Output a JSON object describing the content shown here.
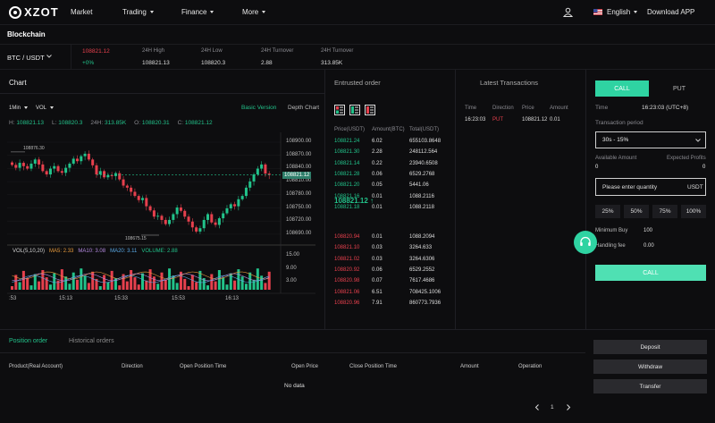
{
  "header": {
    "logo": "XZOT",
    "nav": [
      "Market",
      "Trading",
      "Finance",
      "More"
    ],
    "language": "English",
    "download": "Download APP"
  },
  "section": "Blockchain",
  "ticker": {
    "pair": "BTC / USDT",
    "price": "108821.12",
    "change": "+0%",
    "stats": [
      {
        "label": "24H High",
        "value": "108821.13"
      },
      {
        "label": "24H Low",
        "value": "108820.3"
      },
      {
        "label": "24H Turnover",
        "value": "2.88"
      },
      {
        "label": "24H Turnover",
        "value": "313.85K"
      }
    ]
  },
  "chart": {
    "title": "Chart",
    "interval": "1Min",
    "indicator": "VOL",
    "basic": "Basic Version",
    "depth": "Depth Chart",
    "ohlc": [
      {
        "k": "H:",
        "v": "108821.13"
      },
      {
        "k": "L:",
        "v": "108820.3"
      },
      {
        "k": "24H:",
        "v": "313.85K"
      },
      {
        "k": "O:",
        "v": "108820.31"
      },
      {
        "k": "C:",
        "v": "108821.12"
      }
    ],
    "price_ticks": [
      "108900.00",
      "108870.00",
      "108840.00",
      "108810.00",
      "108780.00",
      "108750.00",
      "108720.00",
      "108690.00"
    ],
    "current": "108821.12",
    "high_label": "108876.30",
    "low_label": "108675.15",
    "vol_legend": [
      {
        "t": "VOL(5,10,20)",
        "c": "#cfcfcf"
      },
      {
        "t": "MA5: 2.33",
        "c": "#e89a3c"
      },
      {
        "t": "MA10: 3.08",
        "c": "#b48ae0"
      },
      {
        "t": "MA20: 3.11",
        "c": "#5aa9e6"
      },
      {
        "t": "VOLUME: 2.88",
        "c": "#22c28a"
      }
    ],
    "vol_ticks": [
      "15.00",
      "9.00",
      "3.00"
    ],
    "time_ticks": [
      ":53",
      "15:13",
      "15:33",
      "15:53",
      "16:13"
    ]
  },
  "chart_data": {
    "type": "candlestick",
    "ylim": [
      108660,
      108915
    ],
    "low": 108675.15,
    "high": 108876.3,
    "last": 108821.12,
    "closes": [
      108845,
      108838,
      108850,
      108842,
      108836,
      108848,
      108858,
      108846,
      108830,
      108822,
      108836,
      108842,
      108830,
      108826,
      108838,
      108848,
      108860,
      108854,
      108866,
      108872,
      108858,
      108844,
      108822,
      108830,
      108815,
      108820,
      108818,
      108825,
      108810,
      108795,
      108790,
      108780,
      108770,
      108760,
      108765,
      108745,
      108735,
      108720,
      108722,
      108712,
      108702,
      108712,
      108726,
      108742,
      108734,
      108720,
      108708,
      108694,
      108684,
      108692,
      108712,
      108726,
      108706,
      108700,
      108716,
      108728,
      108740,
      108750,
      108745,
      108762,
      108770,
      108790,
      108805,
      108822,
      108836,
      108846,
      108824,
      108821
    ]
  },
  "orders": {
    "title": "Entrusted order",
    "cols": [
      "Price(USDT)",
      "Amount(BTC)",
      "Total(USDT)"
    ],
    "bids": [
      [
        "108821.24",
        "6.02",
        "655103.8648"
      ],
      [
        "108821.30",
        "2.28",
        "248112.564"
      ],
      [
        "108821.14",
        "0.22",
        "23940.6508"
      ],
      [
        "108821.28",
        "0.06",
        "6529.2768"
      ],
      [
        "108821.20",
        "0.05",
        "5441.06"
      ],
      [
        "108821.16",
        "0.01",
        "1088.2116"
      ],
      [
        "108821.18",
        "0.01",
        "1088.2118"
      ]
    ],
    "mid": "108821.12 ↑",
    "asks": [
      [
        "108820.94",
        "0.01",
        "1088.2094"
      ],
      [
        "108821.10",
        "0.03",
        "3264.633"
      ],
      [
        "108821.02",
        "0.03",
        "3264.6306"
      ],
      [
        "108820.92",
        "0.06",
        "6529.2552"
      ],
      [
        "108820.98",
        "0.07",
        "7617.4686"
      ],
      [
        "108821.06",
        "6.51",
        "708425.1006"
      ],
      [
        "108820.96",
        "7.91",
        "860773.7936"
      ]
    ]
  },
  "trades": {
    "title": "Latest Transactions",
    "cols": [
      "Time",
      "Direction",
      "Price",
      "Amount"
    ],
    "row": [
      "16:23:03",
      "PUT",
      "108821.12",
      "0.01"
    ]
  },
  "trade": {
    "call": "CALL",
    "put": "PUT",
    "time_label": "Time",
    "time_value": "16:23:03 (UTC+8)",
    "period_label": "Transaction period",
    "period_value": "30s - 15%",
    "avail_label": "Available Amount",
    "avail_value": "0",
    "profit_label": "Expected Profits",
    "profit_value": "0",
    "qty_placeholder": "Please enter  quantity",
    "unit": "USDT",
    "pcts": [
      "25%",
      "50%",
      "75%",
      "100%"
    ],
    "min_label": "Minimum Buy",
    "min_value": "100",
    "fee_label": "Handling fee",
    "fee_value": "0.00",
    "submit": "CALL"
  },
  "positions": {
    "tab1": "Position order",
    "tab2": "Historical orders",
    "cols": [
      "Product(Real Account)",
      "Direction",
      "Open Position Time",
      "Open Price",
      "Close Position Time",
      "Amount",
      "Operation"
    ],
    "empty": "No data",
    "page": "1"
  },
  "wallet": {
    "deposit": "Deposit",
    "withdraw": "Withdraw",
    "transfer": "Transfer"
  }
}
